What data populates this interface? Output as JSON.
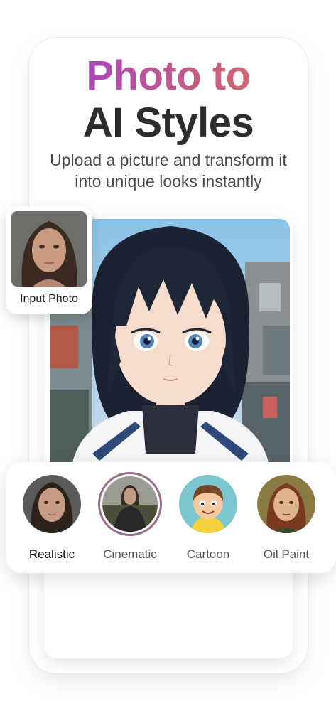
{
  "header": {
    "title_line1": "Photo to",
    "title_line2": "AI Styles",
    "subtitle": "Upload a picture and transform it into unique looks instantly"
  },
  "input_card": {
    "label": "Input Photo"
  },
  "styles": {
    "options": [
      {
        "label": "Realistic"
      },
      {
        "label": "Cinematic"
      },
      {
        "label": "Cartoon"
      },
      {
        "label": "Oil Paint"
      }
    ],
    "selected": "Cinematic"
  },
  "colors": {
    "title_gradient_start": "#9b3bd1",
    "title_gradient_end": "#d8705a",
    "title_dark": "#2d2d2d",
    "selected_ring": "#9a6c8e"
  }
}
